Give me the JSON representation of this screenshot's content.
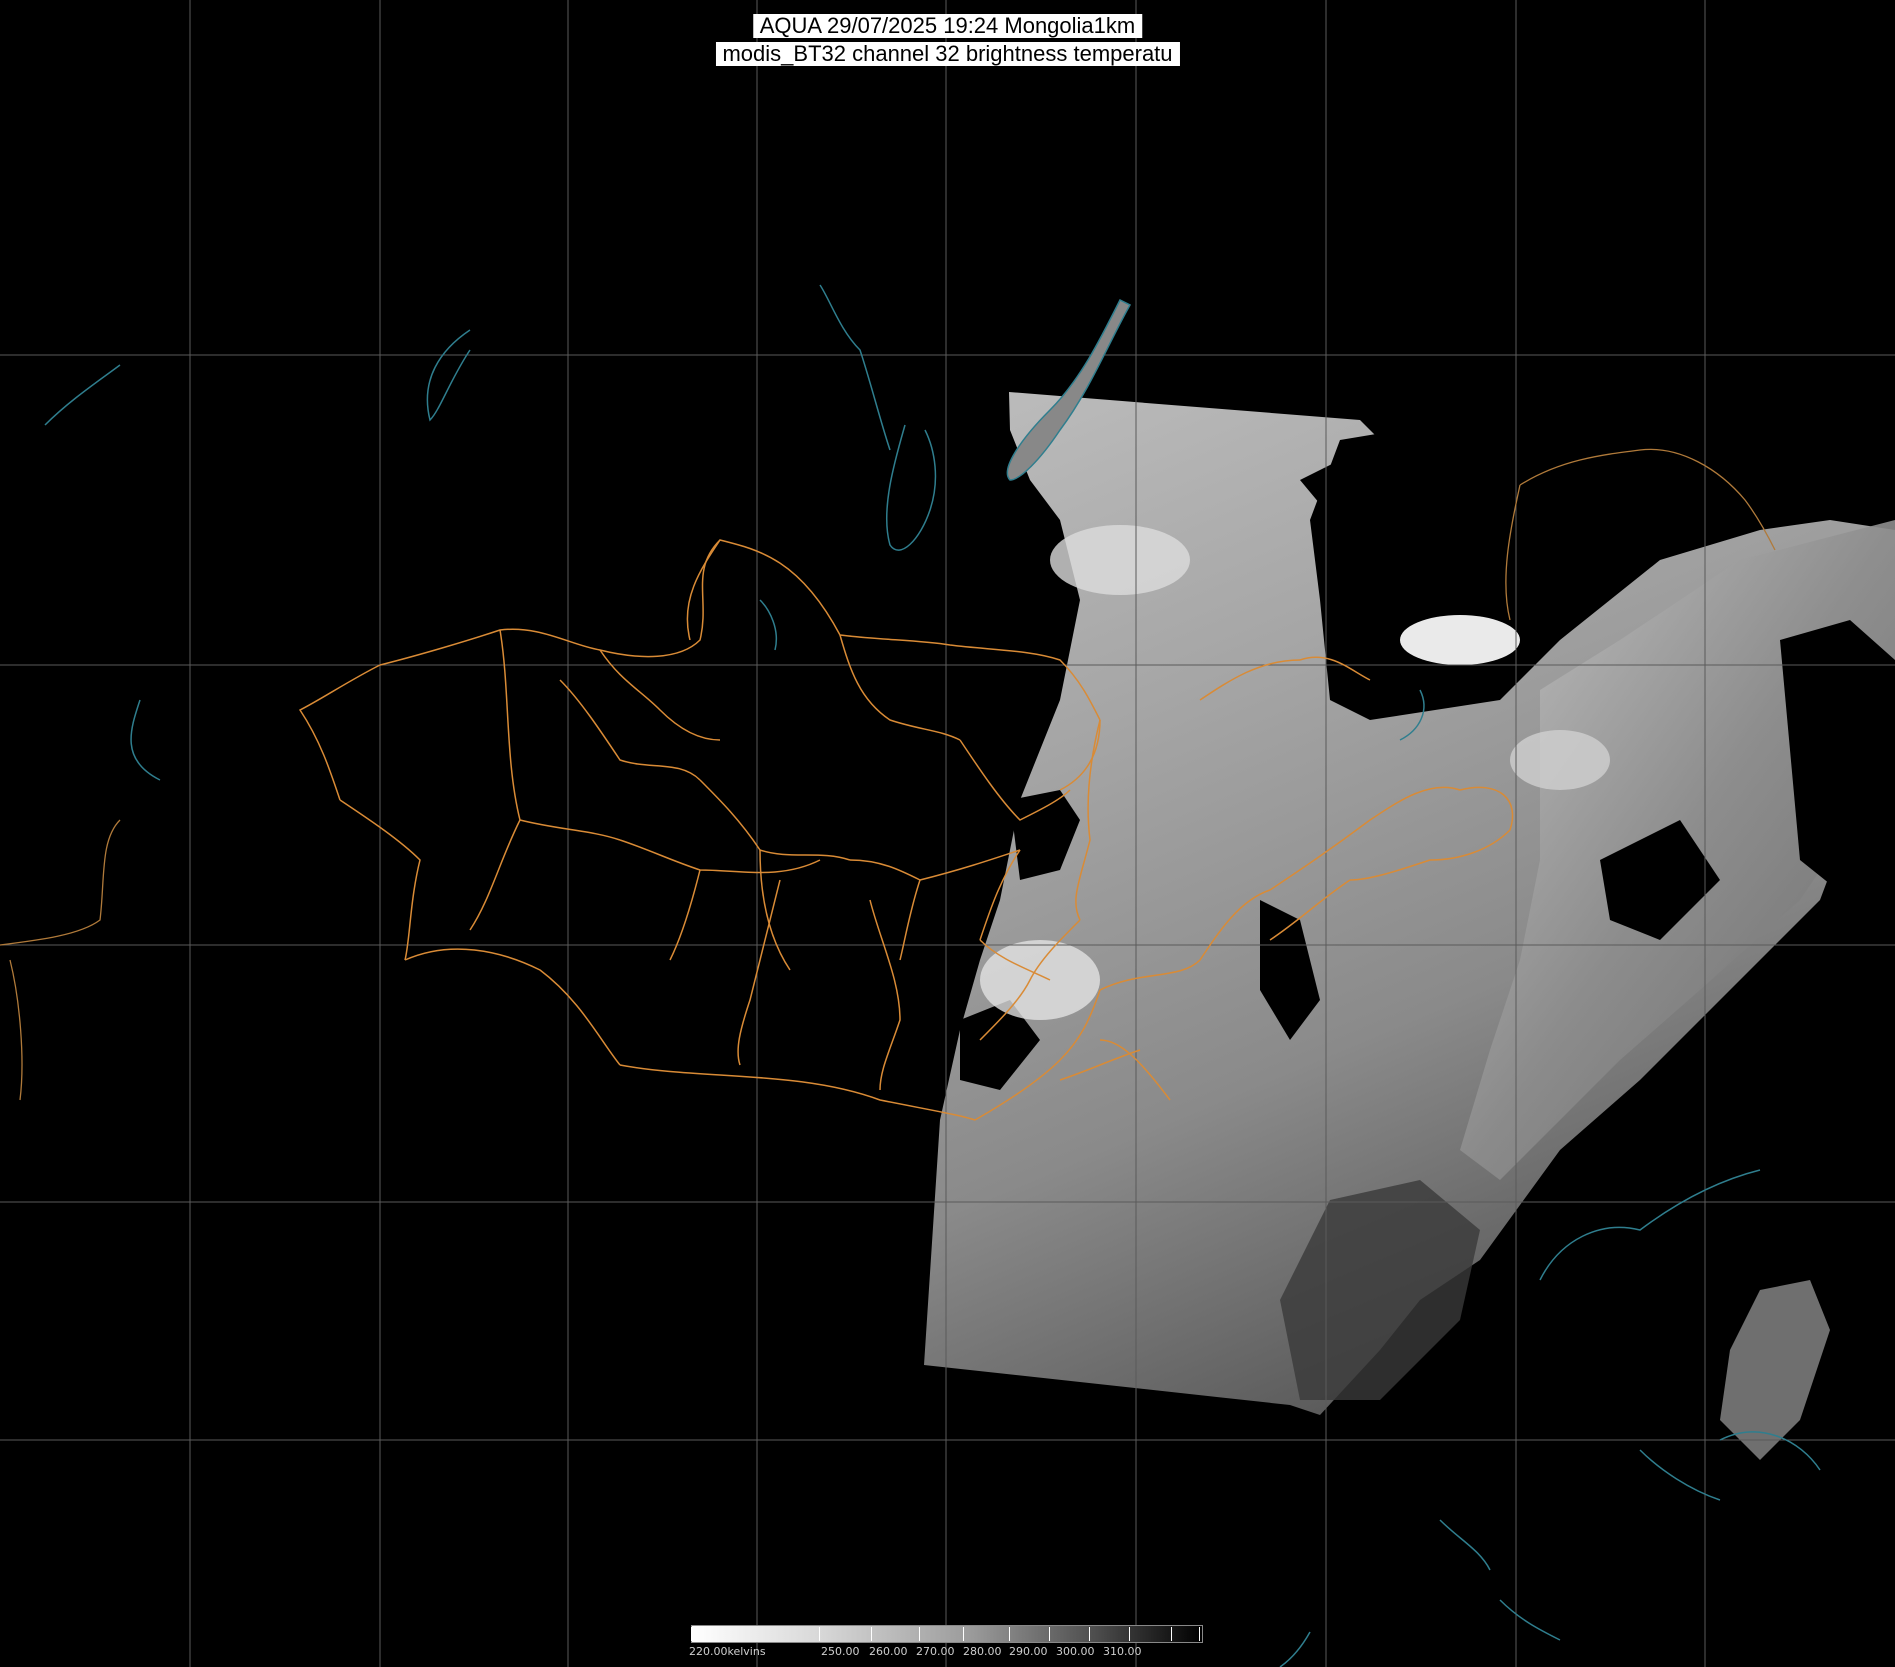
{
  "title": {
    "line1": "AQUA 29/07/2025 19:24 Mongolia1km",
    "line2": "modis_BT32 channel 32 brightness temperatu"
  },
  "colorbar": {
    "unit_label": "220.00kelvins",
    "tick_labels": [
      "250.00",
      "260.00",
      "270.00",
      "280.00",
      "290.00",
      "300.00",
      "310.00"
    ]
  },
  "colors": {
    "background": "#000000",
    "grid": "#5a5a5a",
    "borders": "#d98b36",
    "coast_water": "#2f7e8e",
    "far_coast": "#b07a3a"
  }
}
